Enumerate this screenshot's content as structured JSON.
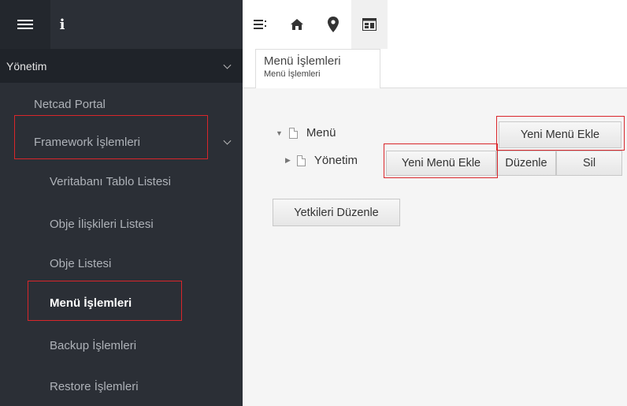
{
  "sidebar": {
    "section": "Yönetim",
    "items": [
      {
        "label": "Netcad Portal"
      },
      {
        "label": "Framework İşlemleri"
      },
      {
        "label": "Veritabanı Tablo Listesi"
      },
      {
        "label": "Obje İlişkileri Listesi"
      },
      {
        "label": "Obje Listesi"
      },
      {
        "label": "Menü İşlemleri"
      },
      {
        "label": "Backup İşlemleri"
      },
      {
        "label": "Restore İşlemleri"
      }
    ],
    "info_glyph": "i"
  },
  "toolbar": {
    "icons": [
      "list-icon",
      "home-icon",
      "map-pin-icon",
      "dashboard-icon"
    ]
  },
  "tab": {
    "title": "Menü İşlemleri",
    "subtitle": "Menü İşlemleri"
  },
  "tree": {
    "root_label": "Menü",
    "root_add": "Yeni Menü Ekle",
    "child_label": "Yönetim",
    "child_add": "Yeni Menü Ekle",
    "child_edit": "Düzenle",
    "child_delete": "Sil"
  },
  "actions": {
    "edit_permissions": "Yetkileri Düzenle"
  },
  "colors": {
    "sidebar_bg": "#2b2f36",
    "highlight": "#d9262b"
  }
}
